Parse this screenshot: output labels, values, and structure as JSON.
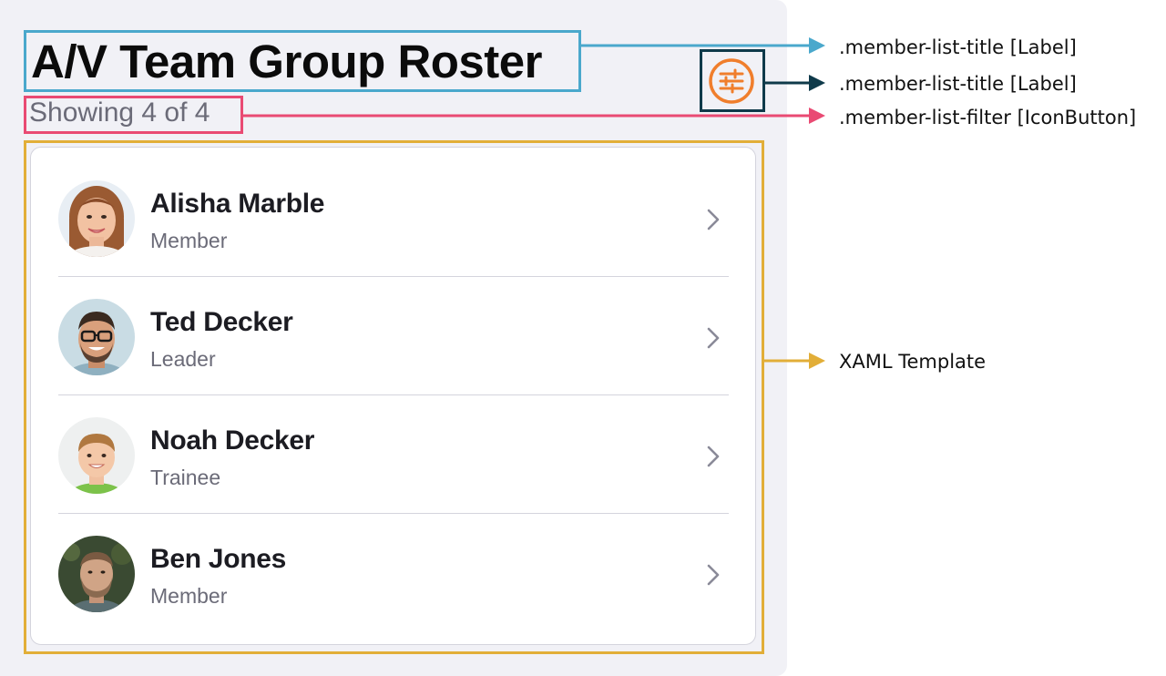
{
  "header": {
    "title": "A/V Team Group Roster",
    "subtitle": "Showing 4 of 4",
    "filter_icon": "filter-sliders-icon"
  },
  "members": [
    {
      "name": "Alisha Marble",
      "role": "Member",
      "avatar": "avatar-woman-smiling"
    },
    {
      "name": "Ted Decker",
      "role": "Leader",
      "avatar": "avatar-man-glasses"
    },
    {
      "name": "Noah Decker",
      "role": "Trainee",
      "avatar": "avatar-boy"
    },
    {
      "name": "Ben Jones",
      "role": "Member",
      "avatar": "avatar-man-beard"
    }
  ],
  "annotations": [
    {
      "label": ".member-list-title [Label]",
      "color": "#4aa8cc"
    },
    {
      "label": ".member-list-title [Label]",
      "color": "#0f3a4a"
    },
    {
      "label": ".member-list-filter [IconButton]",
      "color": "#e94a73"
    },
    {
      "label": "XAML Template",
      "color": "#e2ae38"
    }
  ],
  "colors": {
    "accent": "#f07e2c",
    "panel_bg": "#f1f1f6",
    "role_text": "#6b6b78"
  }
}
